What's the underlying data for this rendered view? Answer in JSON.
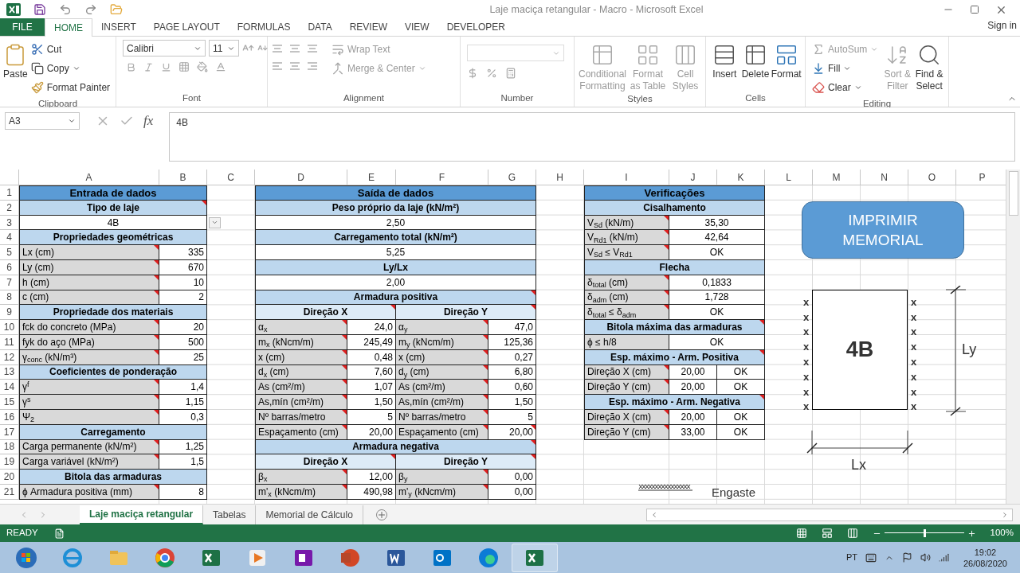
{
  "title_bar": {
    "title": "Laje maciça retangular - Macro - Microsoft Excel"
  },
  "ribbon_tabs": [
    {
      "label": "FILE",
      "kind": "file",
      "selected": false
    },
    {
      "label": "HOME",
      "kind": "tab",
      "selected": true
    },
    {
      "label": "INSERT",
      "kind": "tab",
      "selected": false
    },
    {
      "label": "PAGE LAYOUT",
      "kind": "tab",
      "selected": false
    },
    {
      "label": "FORMULAS",
      "kind": "tab",
      "selected": false
    },
    {
      "label": "DATA",
      "kind": "tab",
      "selected": false
    },
    {
      "label": "REVIEW",
      "kind": "tab",
      "selected": false
    },
    {
      "label": "VIEW",
      "kind": "tab",
      "selected": false
    },
    {
      "label": "DEVELOPER",
      "kind": "tab",
      "selected": false
    }
  ],
  "sign_in": "Sign in",
  "ribbon_groups": [
    {
      "kind": "clipboard",
      "label": "Clipboard",
      "buttons": [
        "Paste",
        "Cut",
        "Copy",
        "Format Painter"
      ]
    },
    {
      "kind": "font",
      "label": "Font",
      "font_name": "Calibri",
      "font_size": "11"
    },
    {
      "kind": "alignment",
      "label": "Alignment",
      "buttons": [
        "Wrap Text",
        "Merge & Center"
      ]
    },
    {
      "kind": "number",
      "label": "Number"
    },
    {
      "kind": "styles",
      "label": "Styles",
      "buttons": [
        "Conditional Formatting",
        "Format as Table",
        "Cell Styles"
      ]
    },
    {
      "kind": "cells",
      "label": "Cells",
      "buttons": [
        "Insert",
        "Delete",
        "Format"
      ]
    },
    {
      "kind": "editing",
      "label": "Editing",
      "buttons": [
        "AutoSum",
        "Fill",
        "Clear",
        "Sort & Filter",
        "Find & Select"
      ]
    }
  ],
  "formula_bar": {
    "name_box": "A3",
    "fx": "fx",
    "value": "4B"
  },
  "sheet": {
    "columns": [
      "A",
      "B",
      "C",
      "D",
      "E",
      "F",
      "G",
      "H",
      "I",
      "J",
      "K",
      "L",
      "M",
      "N",
      "O",
      "P"
    ],
    "rows": [
      "1",
      "2",
      "3",
      "4",
      "5",
      "6",
      "7",
      "8",
      "9",
      "10",
      "11",
      "12",
      "13",
      "14",
      "15",
      "16",
      "17",
      "18",
      "19",
      "20",
      "21"
    ],
    "tables": [
      {
        "rows": [
          [
            {
              "kind": "header",
              "text": "Entrada de dados",
              "comment": false
            }
          ],
          [
            {
              "kind": "section",
              "text": "Tipo de laje",
              "comment": true
            }
          ],
          [
            {
              "kind": "result",
              "text": "4B",
              "comment": false,
              "dropdown": true
            }
          ],
          [
            {
              "kind": "section",
              "text": "Propriedades geométricas",
              "comment": false
            }
          ],
          [
            {
              "kind": "label",
              "text": "Lx (cm)",
              "comment": true
            },
            {
              "kind": "number",
              "text": "335",
              "comment": false
            }
          ],
          [
            {
              "kind": "label",
              "text": "Ly (cm)",
              "comment": true
            },
            {
              "kind": "number",
              "text": "670",
              "comment": false
            }
          ],
          [
            {
              "kind": "label",
              "text": "h (cm)",
              "comment": true
            },
            {
              "kind": "number",
              "text": "10",
              "comment": false
            }
          ],
          [
            {
              "kind": "label",
              "text": "c (cm)",
              "comment": true
            },
            {
              "kind": "number",
              "text": "2",
              "comment": false
            }
          ],
          [
            {
              "kind": "section",
              "text": "Propriedade dos materiais",
              "comment": false
            }
          ],
          [
            {
              "kind": "label",
              "text": "fck do concreto (MPa)",
              "comment": true
            },
            {
              "kind": "number",
              "text": "20",
              "comment": false
            }
          ],
          [
            {
              "kind": "label",
              "text": "fyk do aço (MPa)",
              "comment": true
            },
            {
              "kind": "number",
              "text": "500",
              "comment": false
            }
          ],
          [
            {
              "kind": "label",
              "text": "γ$_{conc}$ (kN/m³)",
              "comment": true
            },
            {
              "kind": "number",
              "text": "25",
              "comment": false
            }
          ],
          [
            {
              "kind": "section",
              "text": "Coeficientes de ponderação",
              "comment": false
            }
          ],
          [
            {
              "kind": "label",
              "text": "γ$^{f}$",
              "comment": true
            },
            {
              "kind": "number",
              "text": "1,4",
              "comment": false
            }
          ],
          [
            {
              "kind": "label",
              "text": "γ$^{s}$",
              "comment": true
            },
            {
              "kind": "number",
              "text": "1,15",
              "comment": false
            }
          ],
          [
            {
              "kind": "label",
              "text": "Ψ$_{2}$",
              "comment": true
            },
            {
              "kind": "number",
              "text": "0,3",
              "comment": false
            }
          ],
          [
            {
              "kind": "section",
              "text": "Carregamento",
              "comment": false
            }
          ],
          [
            {
              "kind": "label",
              "text": "Carga permanente (kN/m²)",
              "comment": true
            },
            {
              "kind": "number",
              "text": "1,25",
              "comment": false
            }
          ],
          [
            {
              "kind": "label",
              "text": "Carga variável (kN/m²)",
              "comment": true
            },
            {
              "kind": "number",
              "text": "1,5",
              "comment": false
            }
          ],
          [
            {
              "kind": "section",
              "text": "Bitola das armaduras",
              "comment": false
            }
          ],
          [
            {
              "kind": "label",
              "text": "ϕ Armadura positiva (mm)",
              "comment": true
            },
            {
              "kind": "number",
              "text": "8",
              "comment": false
            }
          ]
        ]
      },
      {
        "rows": [
          [
            {
              "kind": "header",
              "text": "Saída de dados",
              "comment": false
            }
          ],
          [
            {
              "kind": "section",
              "text": "Peso próprio da laje (kN/m²)",
              "comment": false
            }
          ],
          [
            {
              "kind": "result",
              "text": "2,50",
              "comment": false
            }
          ],
          [
            {
              "kind": "section",
              "text": "Carregamento total (kN/m²)",
              "comment": false
            }
          ],
          [
            {
              "kind": "result",
              "text": "5,25",
              "comment": false
            }
          ],
          [
            {
              "kind": "section",
              "text": "Ly/Lx",
              "comment": false
            }
          ],
          [
            {
              "kind": "result",
              "text": "2,00",
              "comment": false
            }
          ],
          [
            {
              "kind": "section",
              "text": "Armadura positiva",
              "comment": true
            }
          ],
          [
            {
              "kind": "subsection",
              "text": "Direção X",
              "comment": true
            },
            {
              "kind": "subsection",
              "text": "Direção Y",
              "comment": true
            }
          ],
          [
            {
              "kind": "label",
              "text": "α$_{x}$",
              "comment": true
            },
            {
              "kind": "number",
              "text": "24,0",
              "comment": false
            },
            {
              "kind": "label",
              "text": "α$_{y}$",
              "comment": true
            },
            {
              "kind": "number",
              "text": "47,0",
              "comment": false
            }
          ],
          [
            {
              "kind": "label",
              "text": "m$_{x}$ (kNcm/m)",
              "comment": true
            },
            {
              "kind": "number",
              "text": "245,49",
              "comment": false
            },
            {
              "kind": "label",
              "text": "m$_{y}$ (kNcm/m)",
              "comment": true
            },
            {
              "kind": "number",
              "text": "125,36",
              "comment": false
            }
          ],
          [
            {
              "kind": "label",
              "text": "x (cm)",
              "comment": true
            },
            {
              "kind": "number",
              "text": "0,48",
              "comment": false
            },
            {
              "kind": "label",
              "text": "x (cm)",
              "comment": true
            },
            {
              "kind": "number",
              "text": "0,27",
              "comment": false
            }
          ],
          [
            {
              "kind": "label",
              "text": "d$_{x}$ (cm)",
              "comment": true
            },
            {
              "kind": "number",
              "text": "7,60",
              "comment": false
            },
            {
              "kind": "label",
              "text": "d$_{y}$ (cm)",
              "comment": true
            },
            {
              "kind": "number",
              "text": "6,80",
              "comment": false
            }
          ],
          [
            {
              "kind": "label",
              "text": "As (cm²/m)",
              "comment": true
            },
            {
              "kind": "number",
              "text": "1,07",
              "comment": false
            },
            {
              "kind": "label",
              "text": "As (cm²/m)",
              "comment": true
            },
            {
              "kind": "number",
              "text": "0,60",
              "comment": false
            }
          ],
          [
            {
              "kind": "label",
              "text": "As,mín (cm²/m)",
              "comment": true
            },
            {
              "kind": "number",
              "text": "1,50",
              "comment": false
            },
            {
              "kind": "label",
              "text": "As,mín (cm²/m)",
              "comment": true
            },
            {
              "kind": "number",
              "text": "1,50",
              "comment": false
            }
          ],
          [
            {
              "kind": "label",
              "text": "Nº barras/metro",
              "comment": true
            },
            {
              "kind": "number",
              "text": "5",
              "comment": false
            },
            {
              "kind": "label",
              "text": "Nº barras/metro",
              "comment": true
            },
            {
              "kind": "number",
              "text": "5",
              "comment": false
            }
          ],
          [
            {
              "kind": "label",
              "text": "Espaçamento (cm)",
              "comment": true
            },
            {
              "kind": "number",
              "text": "20,00",
              "comment": false
            },
            {
              "kind": "label",
              "text": "Espaçamento (cm)",
              "comment": true
            },
            {
              "kind": "number",
              "text": "20,00",
              "comment": true
            }
          ],
          [
            {
              "kind": "section",
              "text": "Armadura negativa",
              "comment": true
            }
          ],
          [
            {
              "kind": "subsection",
              "text": "Direção X",
              "comment": true
            },
            {
              "kind": "subsection",
              "text": "Direção Y",
              "comment": true
            }
          ],
          [
            {
              "kind": "label",
              "text": "β$_{x}$",
              "comment": true
            },
            {
              "kind": "number",
              "text": "12,00",
              "comment": false
            },
            {
              "kind": "label",
              "text": "β$_{y}$",
              "comment": true
            },
            {
              "kind": "number",
              "text": "0,00",
              "comment": false
            }
          ],
          [
            {
              "kind": "label",
              "text": "m'$_{x}$ (kNcm/m)",
              "comment": true
            },
            {
              "kind": "number",
              "text": "490,98",
              "comment": false
            },
            {
              "kind": "label",
              "text": "m'$_{y}$ (kNcm/m)",
              "comment": true
            },
            {
              "kind": "number",
              "text": "0,00",
              "comment": false
            }
          ]
        ]
      },
      {
        "rows": [
          [
            {
              "kind": "header",
              "text": "Verificações",
              "comment": false
            }
          ],
          [
            {
              "kind": "section",
              "text": "Cisalhamento",
              "comment": false
            }
          ],
          [
            {
              "kind": "label",
              "text": "V$_{Sd}$ (kN/m)",
              "comment": true
            },
            {
              "kind": "result",
              "text": "35,30",
              "comment": false
            }
          ],
          [
            {
              "kind": "label",
              "text": "V$_{Rd1}$ (kN/m)",
              "comment": true
            },
            {
              "kind": "result",
              "text": "42,64",
              "comment": false
            }
          ],
          [
            {
              "kind": "label",
              "text": "V$_{Sd}$ ≤ V$_{Rd1}$",
              "comment": true
            },
            {
              "kind": "result",
              "text": "OK",
              "comment": false
            }
          ],
          [
            {
              "kind": "section",
              "text": "Flecha",
              "comment": false
            }
          ],
          [
            {
              "kind": "label",
              "text": "δ$_{total}$ (cm)",
              "comment": true
            },
            {
              "kind": "result",
              "text": "0,1833",
              "comment": false
            }
          ],
          [
            {
              "kind": "label",
              "text": "δ$_{adm}$ (cm)",
              "comment": true
            },
            {
              "kind": "result",
              "text": "1,728",
              "comment": false
            }
          ],
          [
            {
              "kind": "label",
              "text": "δ$_{total}$ ≤ δ$_{adm}$",
              "comment": true
            },
            {
              "kind": "result",
              "text": "OK",
              "comment": false
            }
          ],
          [
            {
              "kind": "section",
              "text": "Bitola máxima das armaduras",
              "comment": true
            }
          ],
          [
            {
              "kind": "label",
              "text": "ϕ ≤ h/8",
              "comment": false
            },
            {
              "kind": "result",
              "text": "OK",
              "comment": false
            }
          ],
          [
            {
              "kind": "section",
              "text": "Esp. máximo - Arm. Positiva",
              "comment": true
            }
          ],
          [
            {
              "kind": "label",
              "text": "Direção X (cm)",
              "comment": true
            },
            {
              "kind": "result",
              "text": "20,00",
              "comment": false
            },
            {
              "kind": "result",
              "text": "OK",
              "comment": false
            }
          ],
          [
            {
              "kind": "label",
              "text": "Direção Y (cm)",
              "comment": true
            },
            {
              "kind": "result",
              "text": "20,00",
              "comment": false
            },
            {
              "kind": "result",
              "text": "OK",
              "comment": false
            }
          ],
          [
            {
              "kind": "section",
              "text": "Esp. máximo - Arm. Negativa",
              "comment": true
            }
          ],
          [
            {
              "kind": "label",
              "text": "Direção X (cm)",
              "comment": true
            },
            {
              "kind": "result",
              "text": "20,00",
              "comment": false
            },
            {
              "kind": "result",
              "text": "OK",
              "comment": false
            }
          ],
          [
            {
              "kind": "label",
              "text": "Direção Y (cm)",
              "comment": true
            },
            {
              "kind": "result",
              "text": "33,00",
              "comment": false
            },
            {
              "kind": "result",
              "text": "OK",
              "comment": false
            }
          ]
        ]
      }
    ]
  },
  "slab_drawing": {
    "print_button": "IMPRIMIR MEMORIAL",
    "slab_type": "4B",
    "left_supports": [
      "x",
      "x",
      "x",
      "x",
      "x",
      "x",
      "x",
      "x"
    ],
    "right_supports": [
      "x",
      "x",
      "x",
      "x",
      "x",
      "x",
      "x",
      "x"
    ],
    "ly_label": "Ly",
    "lx_label": "Lx",
    "legend_label": "Engaste"
  },
  "sheet_tabs": [
    {
      "label": "Laje maciça retangular",
      "selected": true
    },
    {
      "label": "Tabelas",
      "selected": false
    },
    {
      "label": "Memorial de Cálculo",
      "selected": false
    }
  ],
  "status_bar": {
    "status": "READY",
    "zoom": "100%",
    "zoom_slider": {
      "level": 0.5
    }
  },
  "taskbar": {
    "language": "PT",
    "time": "19:02",
    "date": "26/08/2020"
  }
}
